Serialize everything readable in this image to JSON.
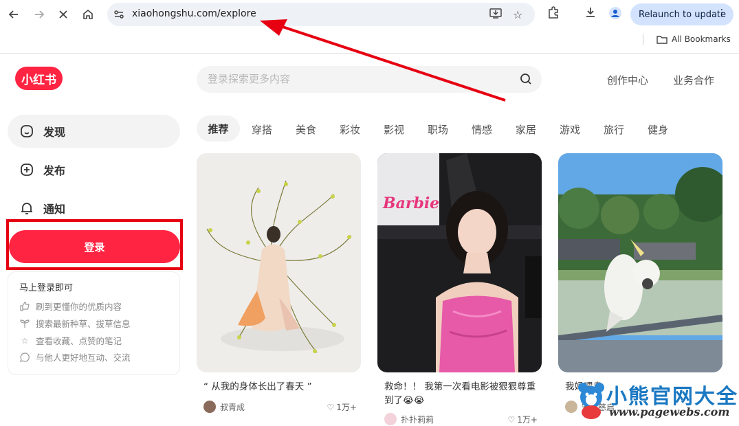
{
  "browser": {
    "url": "xiaohongshu.com/explore",
    "relaunch_label": "Relaunch to update",
    "bookmarks_label": "All Bookmarks"
  },
  "site": {
    "logo_text": "小红书",
    "search_placeholder": "登录探索更多内容",
    "top_links": [
      "创作中心",
      "业务合作"
    ]
  },
  "sidebar": {
    "items": [
      {
        "label": "发现",
        "icon": "home-icon"
      },
      {
        "label": "发布",
        "icon": "plus-square-icon"
      },
      {
        "label": "通知",
        "icon": "bell-icon"
      }
    ],
    "login_label": "登录",
    "login_card": {
      "title": "马上登录即可",
      "tips": [
        {
          "text": "刷到更懂你的优质内容",
          "icon": "thumbs-up-icon"
        },
        {
          "text": "搜索最新种草、拔草信息",
          "icon": "sprout-icon"
        },
        {
          "text": "查看收藏、点赞的笔记",
          "icon": "star-icon"
        },
        {
          "text": "与他人更好地互动、交流",
          "icon": "chat-icon"
        }
      ]
    }
  },
  "tabs": [
    "推荐",
    "穿搭",
    "美食",
    "彩妆",
    "影视",
    "职场",
    "情感",
    "家居",
    "游戏",
    "旅行",
    "健身"
  ],
  "feed": [
    {
      "title": "“ 从我的身体长出了春天 ”",
      "author": "叔青成",
      "likes": "1万+"
    },
    {
      "title": "救命！！ 我第一次看电影被狠狠尊重到了😭😭",
      "author": "扑扑莉莉",
      "likes": "1万+"
    },
    {
      "title": "我妈喂鸟",
      "author": "安在慈启",
      "likes": ""
    }
  ],
  "thumb_texts": {
    "barbie": "Barbie"
  },
  "watermark": {
    "title": "小熊官网大全",
    "url": "www.pagewebs.com"
  },
  "colors": {
    "brand": "#ff2442",
    "annotation": "#e60012",
    "relaunch_bg": "#d3e3fd"
  }
}
